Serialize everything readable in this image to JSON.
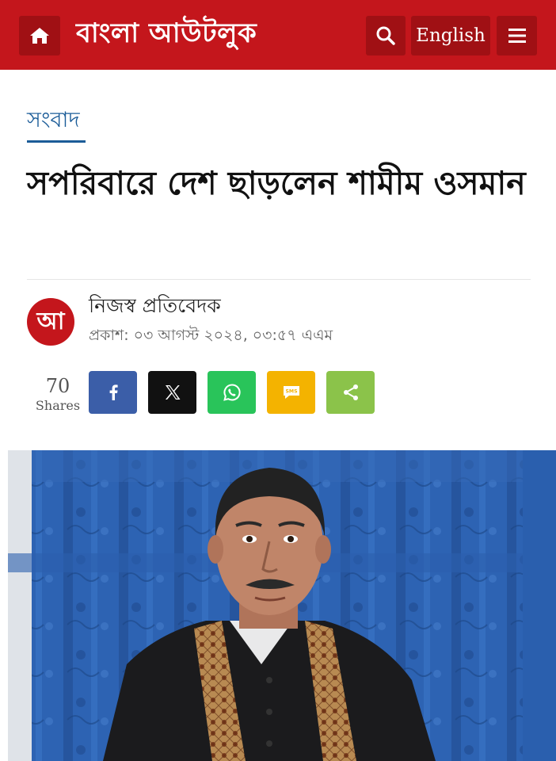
{
  "header": {
    "brand": "বাংলা আউটলুক",
    "language_label": "English",
    "icons": {
      "home": "home-icon",
      "search": "search-icon",
      "menu": "menu-icon"
    },
    "colors": {
      "bar": "#c4161c",
      "button": "#a01014"
    }
  },
  "article": {
    "category": "সংবাদ",
    "headline": "সপরিবারে দেশ ছাড়লেন শামীম ওসমান",
    "author_logo": "আ",
    "author": "নিজস্ব প্রতিবেদক",
    "published": "প্রকাশ: ০৩ আগস্ট ২০২৪, ০৩:৫৭ এএম"
  },
  "share": {
    "count": "70",
    "count_label": "Shares",
    "buttons": [
      {
        "name": "facebook",
        "icon": "facebook-icon",
        "color": "#3b5ea8"
      },
      {
        "name": "x",
        "icon": "x-icon",
        "color": "#111111"
      },
      {
        "name": "whatsapp",
        "icon": "whatsapp-icon",
        "color": "#29c45a"
      },
      {
        "name": "sms",
        "icon": "sms-icon",
        "label": "SMS",
        "color": "#f4b300"
      },
      {
        "name": "share",
        "icon": "share-icon",
        "color": "#8bc34a"
      }
    ]
  }
}
